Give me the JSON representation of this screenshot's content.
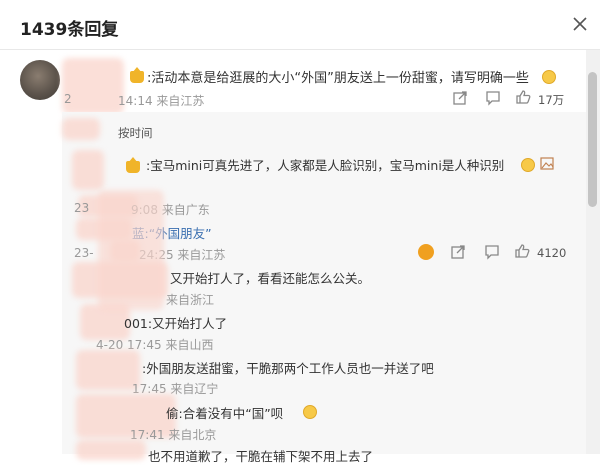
{
  "header": {
    "title": "1439条回复",
    "close_icon": "close-icon"
  },
  "main_comment": {
    "text": ":活动本意是给逛展的大小“外国”朋友送上一份甜蜜，请写明确一些",
    "time_tail": "14:14 来自江苏",
    "date_prefix": "2",
    "like_count": "17万"
  },
  "sort": {
    "label": "按时间"
  },
  "replies": [
    {
      "text": ":宝马mini可真先进了，人家都是人脸识别，宝马mini是人种识别",
      "meta_tail": "9:08 来自广东",
      "meta_prefix": "23",
      "quoted_tail": "蓝:“外国朋友”",
      "second_meta_prefix": "23-",
      "second_meta_tail": "24:25 来自江苏",
      "like_count": "4120"
    },
    {
      "text": "又开始打人了，看看还能怎么公关。",
      "meta_tail": "来自浙江"
    },
    {
      "text": "001:又开始打人了",
      "meta_tail": "4-20 17:45 来自山西"
    },
    {
      "text": ":外国朋友送甜蜜，干脆那两个工作人员也一并送了吧",
      "meta_tail": "17:45 来自辽宁"
    },
    {
      "text": "偷:合着没有中“国”呗",
      "meta_tail": "17:41 来自北京"
    },
    {
      "text": "也不用道歉了，干脆在辅下架不用上去了"
    }
  ],
  "icons": {
    "share": "share-icon",
    "comment": "comment-icon",
    "like": "thumbs-up-icon",
    "warning": "warning-icon",
    "avatar": "avatar",
    "emoji": "emoji-icon",
    "crown": "crown-badge-icon"
  }
}
